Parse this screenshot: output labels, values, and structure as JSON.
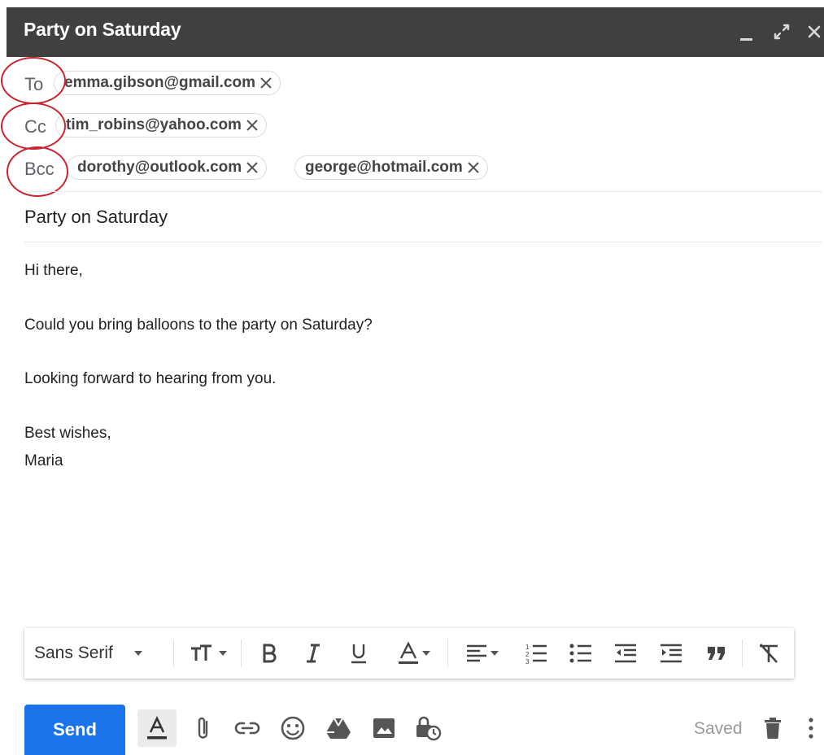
{
  "window": {
    "title": "Party on Saturday"
  },
  "recipients": {
    "to": {
      "label": "To",
      "chips": [
        "emma.gibson@gmail.com"
      ]
    },
    "cc": {
      "label": "Cc",
      "chips": [
        "tim_robins@yahoo.com"
      ]
    },
    "bcc": {
      "label": "Bcc",
      "chips": [
        "dorothy@outlook.com",
        "george@hotmail.com"
      ]
    }
  },
  "subject": "Party on Saturday",
  "body": {
    "greeting": "Hi there,",
    "line1": "Could you bring balloons to the party on Saturday?",
    "line2": "Looking forward to hearing from you.",
    "signoff": "Best wishes,",
    "name": "Maria"
  },
  "toolbar": {
    "font": "Sans Serif",
    "icons": [
      "font-size-icon",
      "bold-icon",
      "italic-icon",
      "underline-icon",
      "text-color-icon",
      "align-icon",
      "numbered-list-icon",
      "bulleted-list-icon",
      "indent-less-icon",
      "indent-more-icon",
      "quote-icon",
      "remove-formatting-icon"
    ]
  },
  "bottom": {
    "send_label": "Send",
    "saved_label": "Saved"
  },
  "colors": {
    "titlebar": "#404040",
    "send": "#1a73e8",
    "annotation": "#c8242d"
  }
}
